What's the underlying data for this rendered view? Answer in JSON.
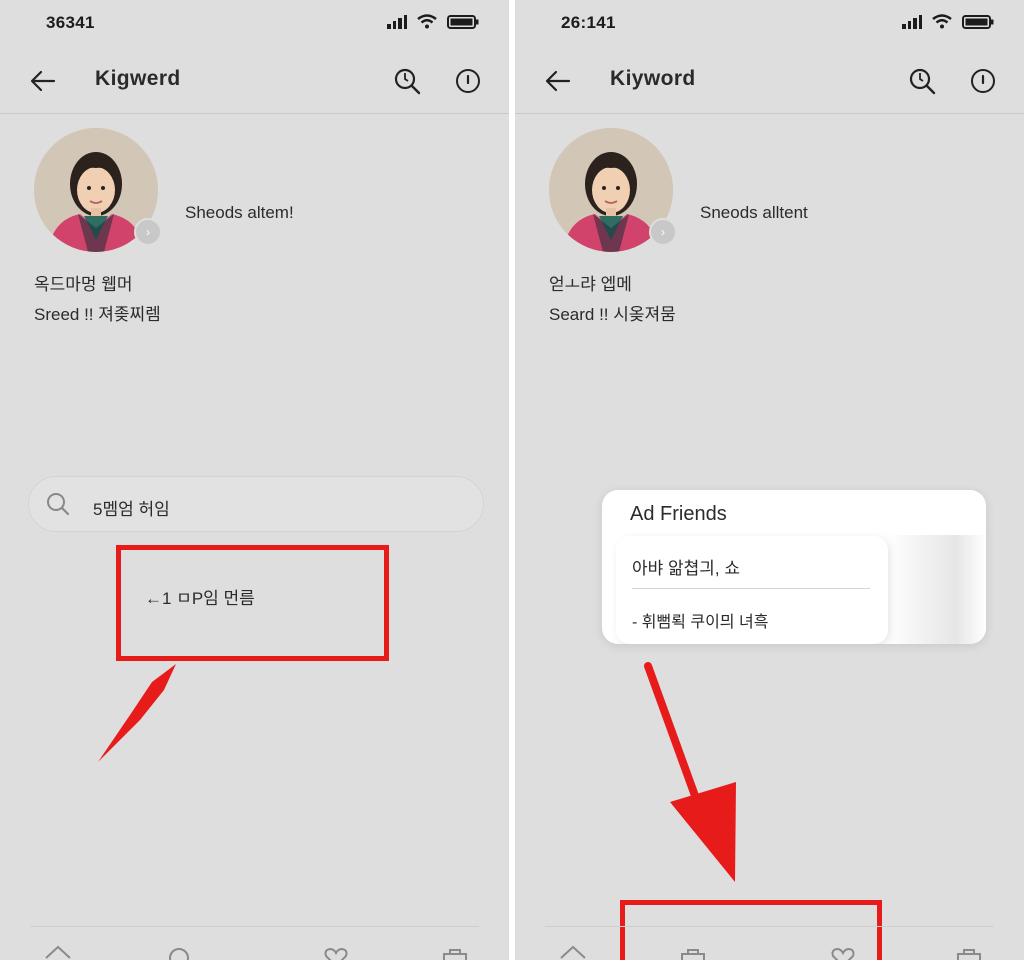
{
  "left_screen": {
    "status_time": "36341",
    "title": "Kigwerd",
    "profile": {
      "status_text": "Sheods altem!",
      "line1": "옥드마멍 웹머",
      "line2": "Sreed !! 져좆찌렘"
    },
    "search": {
      "value": "5멤엄 허임"
    },
    "highlight_label": "←1 ㅁP임 먼름",
    "icons": {
      "back": "back-arrow-icon",
      "search": "search-icon",
      "info": "info-icon",
      "tabs": [
        "home-icon",
        "search-icon",
        "heart-icon",
        "bag-icon"
      ]
    }
  },
  "right_screen": {
    "status_time": "26:141",
    "title": "Kiyword",
    "profile": {
      "status_text": "Sneods alltent",
      "line1": "얻ㅗ랴 엡메",
      "line2": "Seard !! 시옺져뭄"
    },
    "popup": {
      "title": "Ad Friends",
      "item1": "아뱌 앎쳡긔, 쇼",
      "item2": "- 휘뻠뢱 쿠이믜 녀흑"
    },
    "icons": {
      "back": "back-arrow-icon",
      "search": "search-icon",
      "info": "info-icon",
      "tabs": [
        "home-icon",
        "bag-icon",
        "heart-icon",
        "bag-icon"
      ]
    }
  },
  "colors": {
    "highlight": "#e81b1b",
    "screen_background": "#dedede",
    "popup_background": "#ffffff"
  }
}
